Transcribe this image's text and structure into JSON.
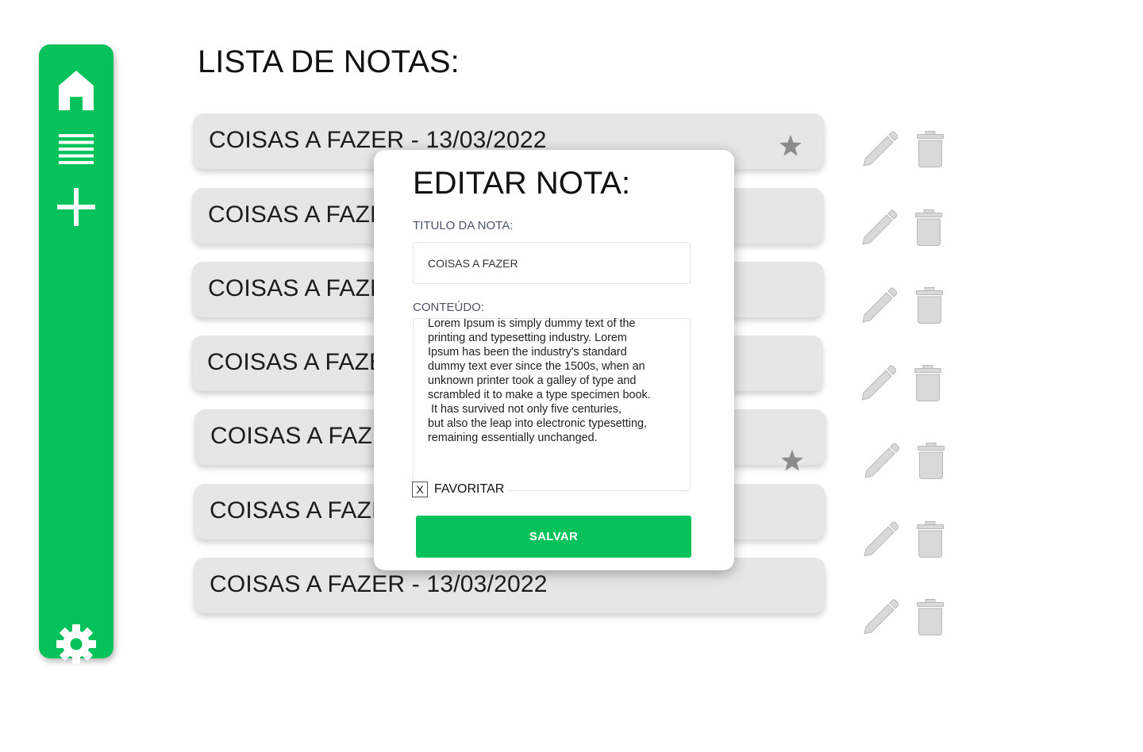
{
  "sidebar": {
    "icons": [
      "home-icon",
      "list-icon",
      "plus-icon",
      "gear-icon"
    ],
    "color": "#06c25a"
  },
  "page": {
    "title": "LISTA DE NOTAS:"
  },
  "notes": [
    {
      "title": "COISAS A FAZER - 13/03/2022",
      "favorite": true
    },
    {
      "title": "COISAS A FAZER - 13/03/2022",
      "favorite": false
    },
    {
      "title": "COISAS A FAZER - 13/03/2022",
      "favorite": false
    },
    {
      "title": "COISAS A FAZER - 13/03/2022",
      "favorite": false
    },
    {
      "title": "COISAS A FAZER - 13/03/2022",
      "favorite": true
    },
    {
      "title": "COISAS A FAZER - 13/03/2022",
      "favorite": false
    },
    {
      "title": "COISAS A FAZER - 13/03/2022",
      "favorite": false
    }
  ],
  "actions": {
    "edit_icon": "pencil-icon",
    "delete_icon": "trash-icon",
    "icon_color": "#d9d9d9"
  },
  "modal": {
    "title": "EDITAR NOTA:",
    "title_label": "TITULO DA NOTA:",
    "title_value": "COISAS A FAZER",
    "content_label": "CONTEÚDO:",
    "content_value": "Lorem Ipsum is simply dummy text of the\nprinting and typesetting industry. Lorem\nIpsum has been the industry's standard\ndummy text ever since the 1500s, when an\nunknown printer took a galley of type and\nscrambled it to make a type specimen book.\n It has survived not only five centuries,\nbut also the leap into electronic typesetting,\nremaining essentially unchanged.",
    "favorite_mark": "X",
    "favorite_label": "FAVORITAR",
    "save_label": "SALVAR"
  }
}
